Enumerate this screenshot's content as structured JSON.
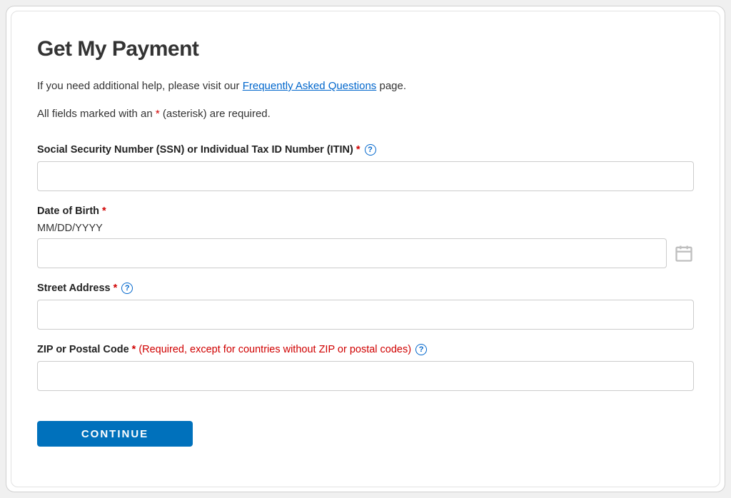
{
  "title": "Get My Payment",
  "help_text_prefix": "If you need additional help, please visit our ",
  "faq_link_text": "Frequently Asked Questions",
  "help_text_suffix": " page.",
  "required_note_prefix": "All fields marked with an ",
  "required_asterisk": "*",
  "required_note_suffix": " (asterisk) are required.",
  "fields": {
    "ssn": {
      "label": "Social Security Number (SSN) or Individual Tax ID Number (ITIN)",
      "value": ""
    },
    "dob": {
      "label": "Date of Birth",
      "format_hint": "MM/DD/YYYY",
      "value": ""
    },
    "street": {
      "label": "Street Address",
      "value": ""
    },
    "zip": {
      "label": "ZIP or Postal Code",
      "extra_note": "(Required, except for countries without ZIP or postal codes)",
      "value": ""
    }
  },
  "continue_button": "CONTINUE",
  "help_icon_char": "?"
}
